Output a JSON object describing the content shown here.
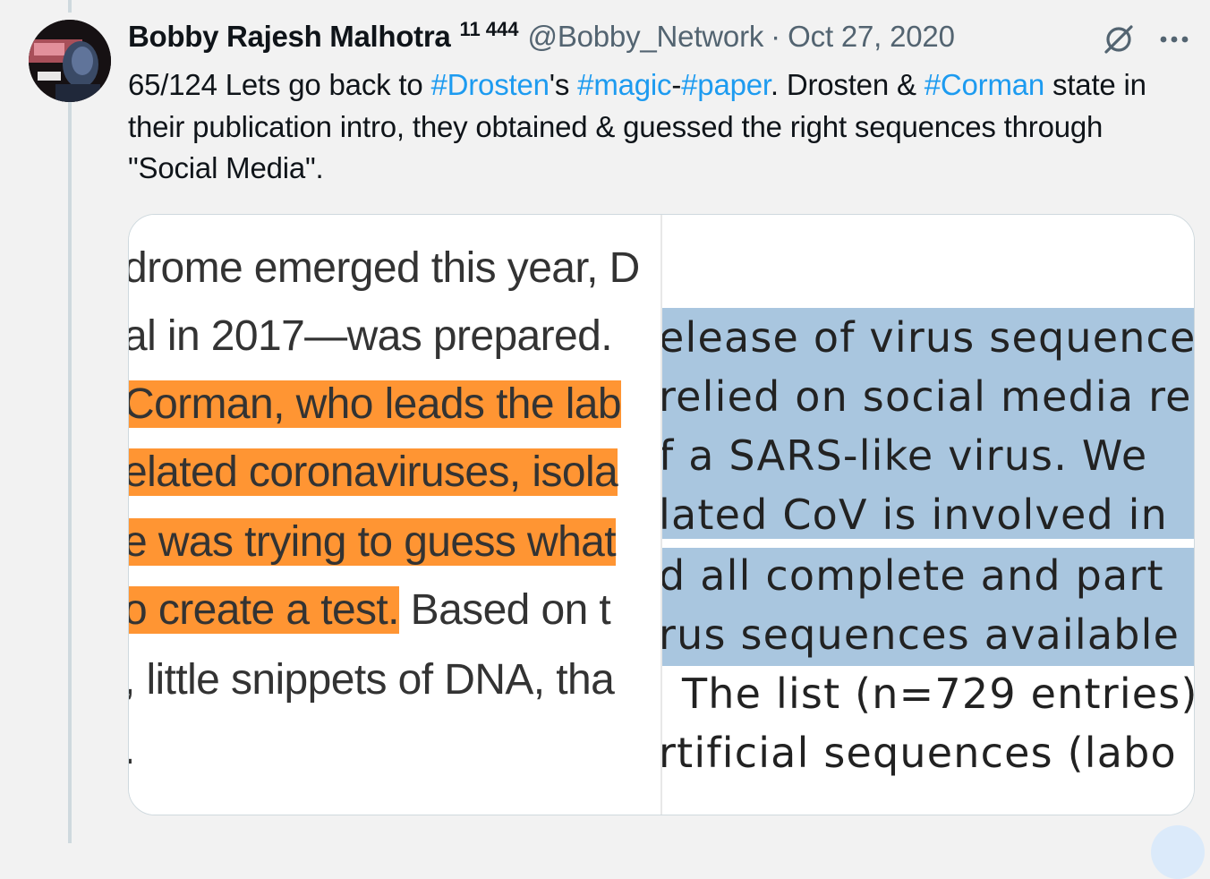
{
  "author": {
    "name": "Bobby Rajesh Malhotra",
    "superscript": "11 444",
    "handle": "@Bobby_Network",
    "separator": "·",
    "date": "Oct 27, 2020"
  },
  "icons": {
    "grok": "grok-icon",
    "more": "more-options-icon",
    "avatar": "avatar"
  },
  "tweet": {
    "t1": "65/124 Lets go back to ",
    "tag_drosten": "#Drosten",
    "t2": "'s ",
    "tag_magic": "#magic",
    "t3": "-",
    "tag_paper": "#paper",
    "t4": ". Drosten & ",
    "tag_corman": "#Corman",
    "t5": " state in their publication intro, they obtained & guessed the right sequences through \"Social Media\"."
  },
  "media": {
    "left_lines": [
      {
        "plain_before": "drome emerged this year, D",
        "highlight": "",
        "plain_after": ""
      },
      {
        "plain_before": "al in 2017—was prepared. ",
        "highlight": "",
        "plain_after": ""
      },
      {
        "plain_before": "",
        "highlight": "Corman, who leads the lab",
        "plain_after": ""
      },
      {
        "plain_before": "",
        "highlight": "elated coronaviruses, isola",
        "plain_after": ""
      },
      {
        "plain_before": "",
        "highlight": "e was trying to guess what",
        "plain_after": ""
      },
      {
        "plain_before": "",
        "highlight": "o create a test.",
        "plain_after": " Based on t"
      },
      {
        "plain_before": ", little snippets of DNA, tha",
        "highlight": "",
        "plain_after": ""
      },
      {
        "plain_before": ".",
        "highlight": "",
        "plain_after": ""
      }
    ],
    "right_lines": [
      "elease of virus sequences",
      "relied on social media re",
      "f a SARS-like virus. We",
      "lated CoV is involved in",
      "d all complete and part",
      "rus sequences available",
      "The list (n=729 entries)",
      "rtificial sequences (labo"
    ]
  },
  "colors": {
    "link": "#1d9bf0",
    "muted": "#536471",
    "highlight_orange": "#ff9533",
    "highlight_blue": "#a9c6df",
    "background": "#f2f2f2"
  }
}
